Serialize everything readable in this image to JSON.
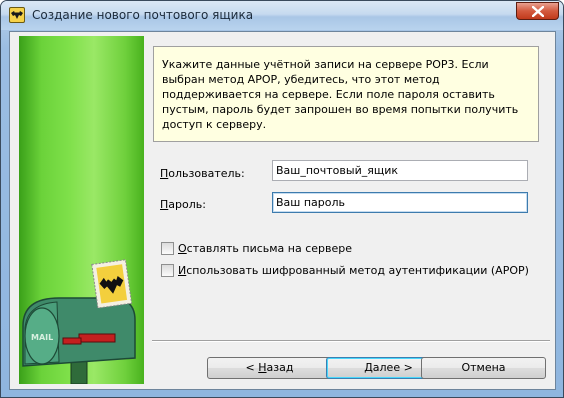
{
  "window": {
    "title": "Создание нового почтового ящика"
  },
  "info": {
    "text": "Укажите данные учётной записи на сервере POP3. Если выбран метод APOP, убедитесь, что этот метод поддерживается на сервере. Если поле пароля оставить пустым, пароль будет запрошен во время попытки получить доступ к серверу."
  },
  "form": {
    "user_label_first": "П",
    "user_label_rest": "ользователь:",
    "user_value": "Ваш_почтовый_ящик",
    "password_label_first": "П",
    "password_label_rest": "ароль:",
    "password_value": "Ваш пароль"
  },
  "options": {
    "keep_on_server_first": "О",
    "keep_on_server_rest": "ставлять письма на сервере",
    "keep_on_server_checked": false,
    "apop_first": "И",
    "apop_rest": "спользовать шифрованный метод аутентификации (APOP)",
    "apop_checked": false
  },
  "buttons": {
    "back_prefix": "<  ",
    "back_first": "Н",
    "back_rest": "азад",
    "next_first": "Д",
    "next_rest": "алее",
    "next_suffix": "  >",
    "cancel": "Отмена"
  },
  "icons": {
    "app": "bat-icon",
    "close": "close-icon",
    "side_art": "mailbox-illustration",
    "mailbox_text": "MAIL"
  },
  "colors": {
    "info_background": "#ffffe1",
    "side_panel_green": "#6bd23a"
  }
}
